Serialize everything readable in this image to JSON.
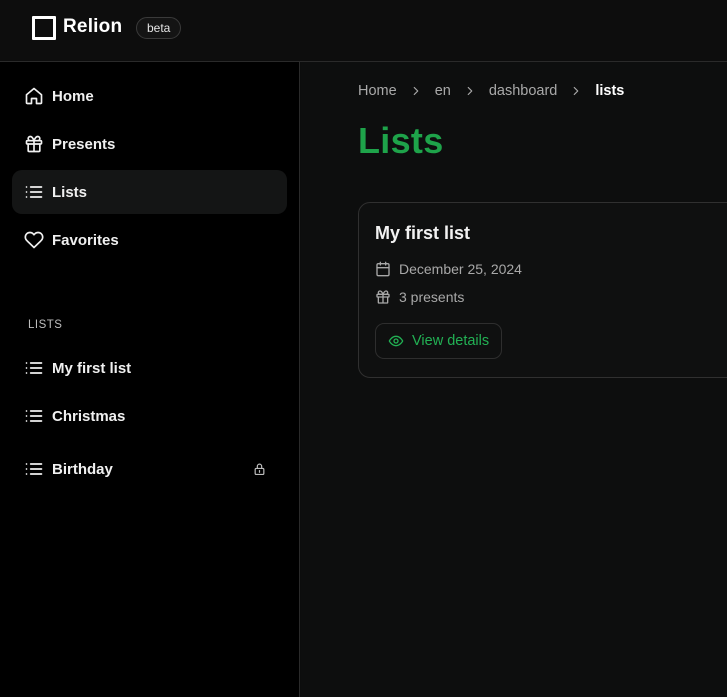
{
  "app": {
    "name": "Relion",
    "badge": "beta"
  },
  "sidebar": {
    "nav": [
      {
        "label": "Home",
        "icon": "home-icon"
      },
      {
        "label": "Presents",
        "icon": "gift-icon"
      },
      {
        "label": "Lists",
        "icon": "list-icon",
        "active": true
      },
      {
        "label": "Favorites",
        "icon": "heart-icon"
      }
    ],
    "section_label": "LISTS",
    "lists": [
      {
        "label": "My first list",
        "icon": "list-icon"
      },
      {
        "label": "Christmas",
        "icon": "list-icon"
      },
      {
        "label": "Birthday",
        "icon": "list-icon",
        "locked": true
      }
    ]
  },
  "breadcrumb": [
    "Home",
    "en",
    "dashboard",
    "lists"
  ],
  "page": {
    "title": "Lists"
  },
  "cards": [
    {
      "title": "My first list",
      "date": "December 25, 2024",
      "presents": "3 presents",
      "action": "View details"
    }
  ],
  "colors": {
    "accent": "#1ea34a",
    "background": "#0d0e0e",
    "sidebar": "#000000"
  }
}
